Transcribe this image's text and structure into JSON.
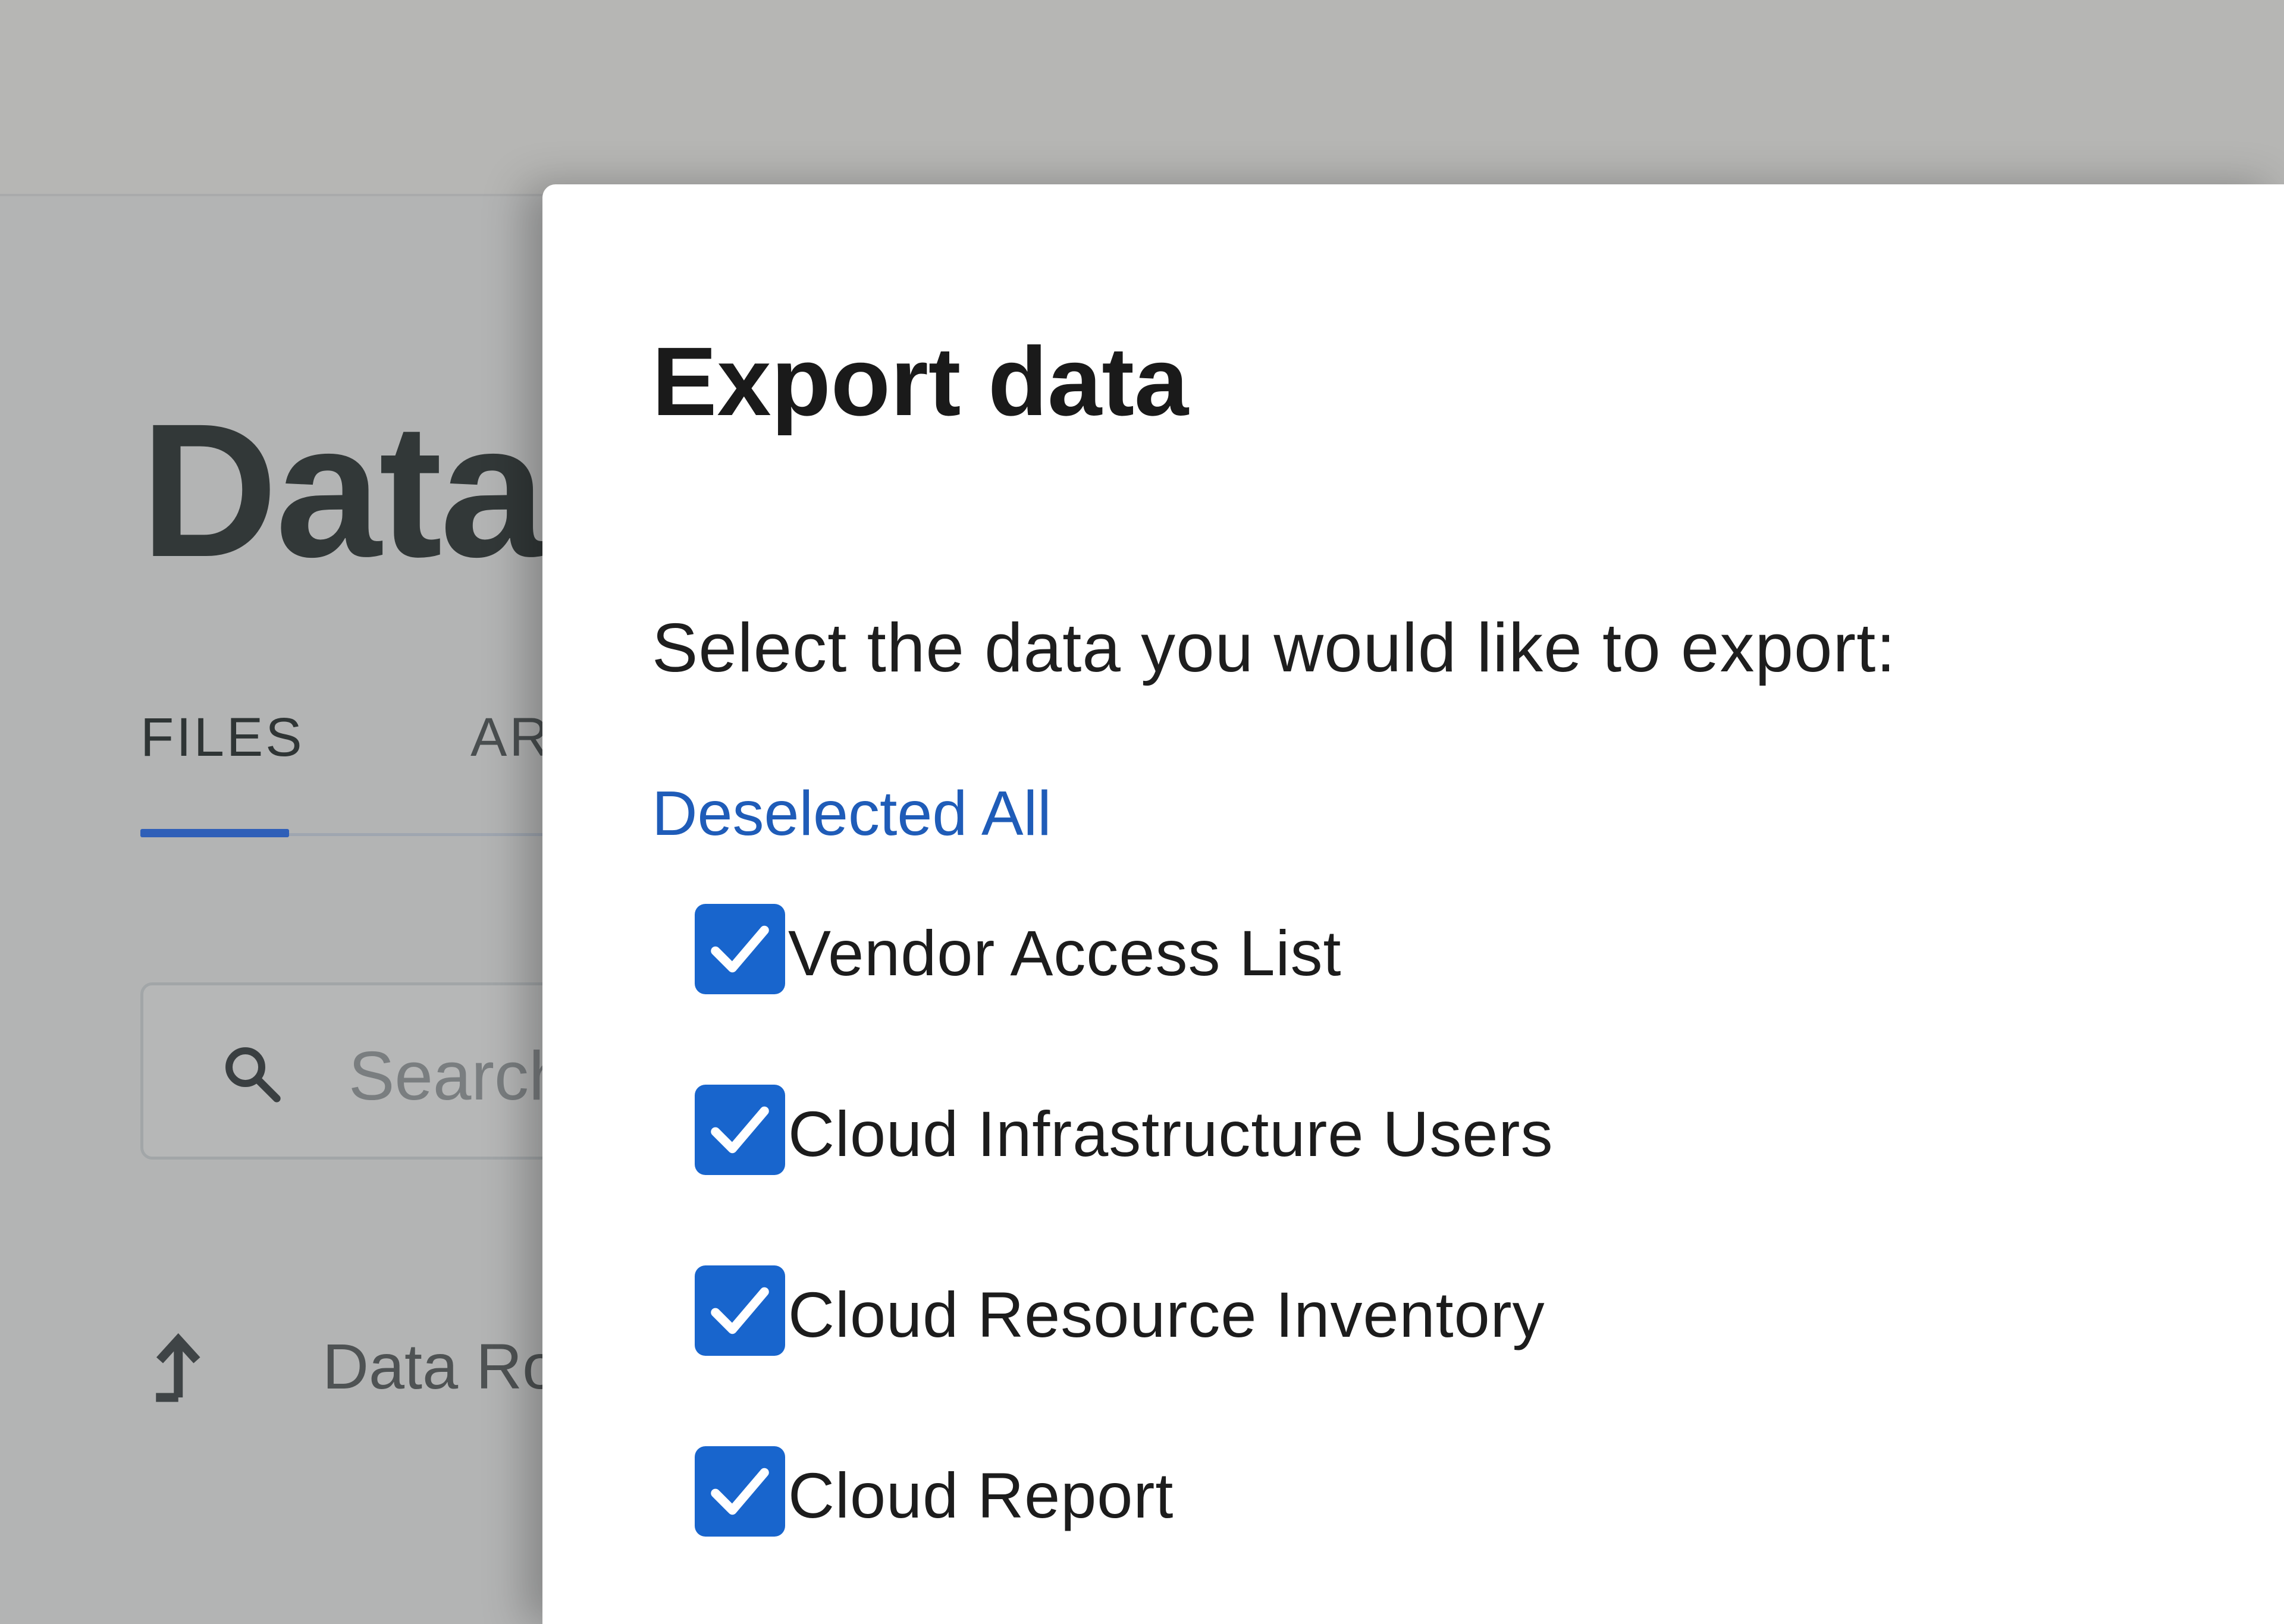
{
  "background": {
    "page_title": "Data",
    "tabs": [
      {
        "label": "FILES",
        "active": true
      },
      {
        "label": "AR",
        "active": false
      }
    ],
    "search": {
      "placeholder": "Search"
    },
    "row": {
      "label": "Data Ro",
      "icon": "upload-arrow-icon"
    }
  },
  "modal": {
    "title": "Export data",
    "prompt": "Select the data you would like to export:",
    "deselect_label": "Deselected All",
    "items": [
      {
        "label": "Vendor Access List",
        "checked": true
      },
      {
        "label": "Cloud Infrastructure Users",
        "checked": true
      },
      {
        "label": "Cloud Resource Inventory",
        "checked": true
      },
      {
        "label": "Cloud Report",
        "checked": true
      }
    ]
  },
  "colors": {
    "accent": "#1865cd",
    "link": "#1f5cb8",
    "overlay": "#b9b9b9",
    "modal_bg": "#ffffff"
  }
}
